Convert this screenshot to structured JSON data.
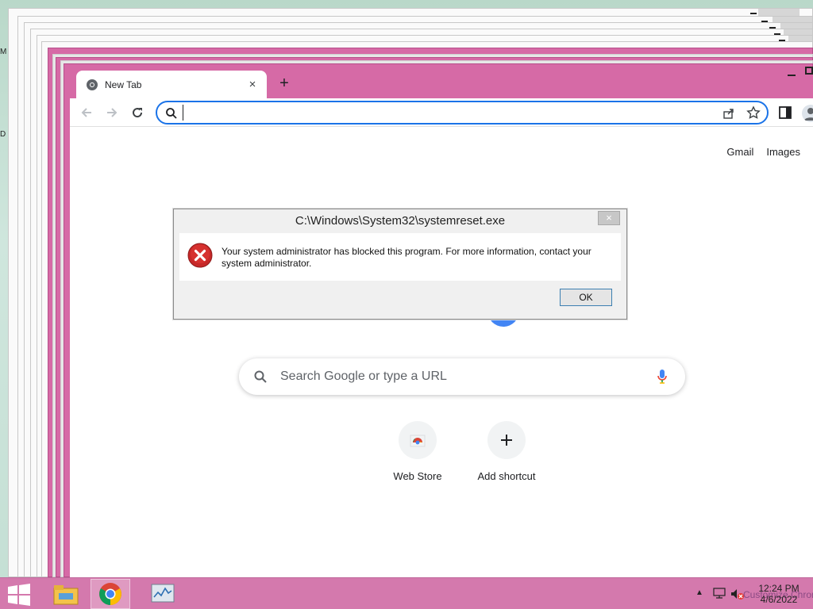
{
  "desktop": {
    "glyph_1": "M",
    "glyph_2": "D"
  },
  "browser": {
    "tab": {
      "title": "New Tab",
      "close": "×"
    },
    "new_tab": "+",
    "omnibox": {
      "value": "",
      "placeholder": ""
    },
    "page": {
      "top_links": [
        "Gmail",
        "Images"
      ],
      "search_placeholder": "Search Google or type a URL",
      "shortcuts": [
        {
          "label": "Web Store",
          "icon": "webstore-icon"
        },
        {
          "label": "Add shortcut",
          "icon": "plus-icon"
        }
      ]
    }
  },
  "dialog": {
    "title": "C:\\Windows\\System32\\systemreset.exe",
    "close": "×",
    "message": "Your system administrator has blocked this program. For more information, contact your system administrator.",
    "ok_label": "OK",
    "icon": "error-icon"
  },
  "taskbar": {
    "items": [
      "file-explorer-icon",
      "chrome-icon",
      "task-manager-icon"
    ],
    "tray_arrow": "▲",
    "time": "12:24 PM",
    "date": "4/6/2022",
    "overlap_text": "Customize Chrome"
  },
  "colors": {
    "accent": "#1a73e8",
    "frame_pink": "#d66aa6",
    "taskbar_pink": "#d479ad",
    "error_red": "#c62828"
  }
}
